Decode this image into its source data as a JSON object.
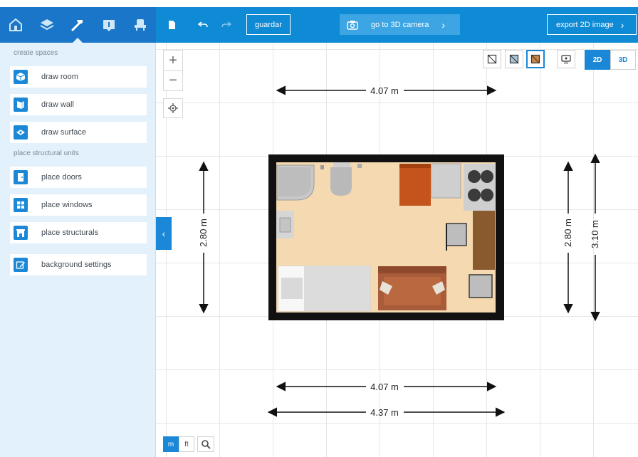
{
  "sidebar": {
    "tabs": [
      {
        "icon": "house-room-icon"
      },
      {
        "icon": "layers-icon"
      },
      {
        "icon": "hammer-icon"
      },
      {
        "icon": "info-panel-icon"
      },
      {
        "icon": "chair-icon"
      }
    ],
    "sections": {
      "create": "create spaces",
      "structural": "place structural units"
    },
    "items": {
      "draw_room": "draw room",
      "draw_wall": "draw wall",
      "draw_surface": "draw surface",
      "place_doors": "place doors",
      "place_windows": "place windows",
      "place_structurals": "place structurals",
      "background_settings": "background settings"
    }
  },
  "toolbar": {
    "save_label": "guardar",
    "camera_label": "go to 3D camera",
    "export_label": "export 2D image"
  },
  "view": {
    "mode_2d": "2D",
    "mode_3d": "3D"
  },
  "units": {
    "metric": "m",
    "imperial": "ft"
  },
  "dimensions": {
    "top_width": "4.07 m",
    "bottom_inner": "4.07 m",
    "bottom_outer": "4.37 m",
    "left_height": "2.80 m",
    "right_inner": "2.80 m",
    "right_outer": "3.10 m"
  },
  "colors": {
    "accent": "#1a88d6",
    "topbar": "#0f8ad4",
    "sidebar_bg": "#e2f1fb",
    "floor": "#f5d9b0",
    "wall": "#111111"
  }
}
